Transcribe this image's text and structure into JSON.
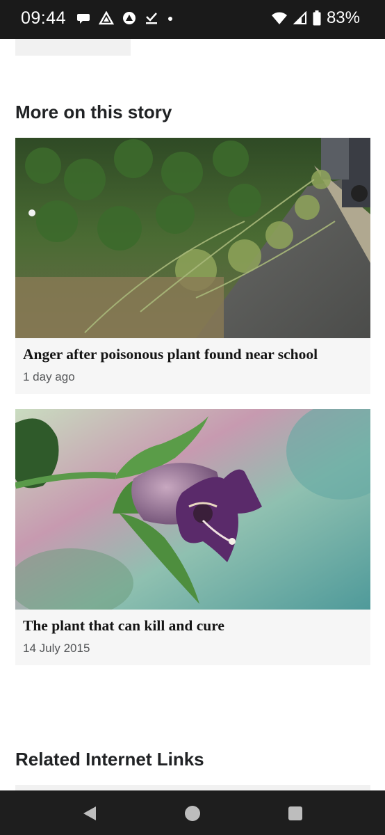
{
  "status_bar": {
    "time": "09:44",
    "battery": "83%",
    "left_icons": [
      "message-icon",
      "drive-icon",
      "vpn-icon",
      "check-download-icon",
      "dot-icon"
    ],
    "right_icons": [
      "wifi-icon",
      "signal-icon",
      "battery-icon"
    ]
  },
  "sections": {
    "more_heading": "More on this story",
    "related_heading": "Related Internet Links"
  },
  "stories": [
    {
      "title": "Anger after poisonous plant found near school",
      "date": "1 day ago",
      "image": "roadside hedge with plant"
    },
    {
      "title": "The plant that can kill and cure",
      "date": "14 July 2015",
      "image": "purple bell flower"
    }
  ],
  "nav": {
    "icons": [
      "back-icon",
      "home-icon",
      "recents-icon"
    ]
  },
  "colors": {
    "status_bg": "#1a1a1a",
    "nav_bg": "#1e1e1e",
    "card_bg": "#f6f6f6"
  }
}
